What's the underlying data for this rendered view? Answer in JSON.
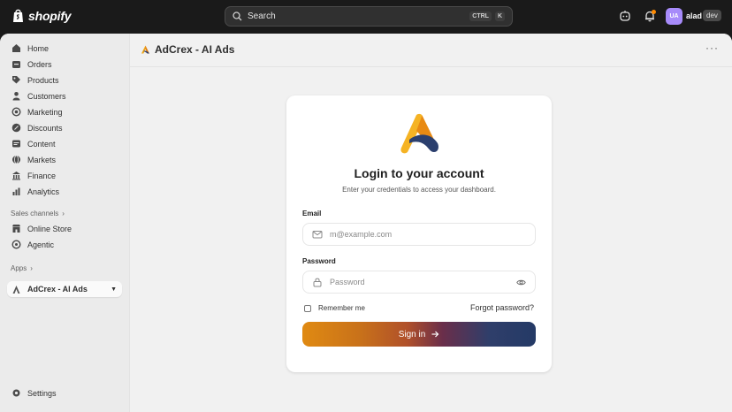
{
  "topbar": {
    "brand": "shopify",
    "search": {
      "label": "Search",
      "shortcut": [
        "CTRL",
        "K"
      ]
    },
    "user": {
      "initials": "UA",
      "name": "alad",
      "badge": "dev"
    }
  },
  "sidebar": {
    "items": [
      {
        "label": "Home",
        "icon": "home-icon"
      },
      {
        "label": "Orders",
        "icon": "orders-icon"
      },
      {
        "label": "Products",
        "icon": "tag-icon"
      },
      {
        "label": "Customers",
        "icon": "person-icon"
      },
      {
        "label": "Marketing",
        "icon": "target-icon"
      },
      {
        "label": "Discounts",
        "icon": "discount-icon"
      },
      {
        "label": "Content",
        "icon": "content-icon"
      },
      {
        "label": "Markets",
        "icon": "globe-icon"
      },
      {
        "label": "Finance",
        "icon": "bank-icon"
      },
      {
        "label": "Analytics",
        "icon": "chart-icon"
      }
    ],
    "sales_channels_label": "Sales channels",
    "sales_channels": [
      {
        "label": "Online Store",
        "icon": "store-icon"
      },
      {
        "label": "Agentic",
        "icon": "agentic-icon"
      }
    ],
    "apps_label": "Apps",
    "active_app": "AdCrex - AI Ads",
    "settings_label": "Settings"
  },
  "page": {
    "title": "AdCrex - AI Ads",
    "more": "···"
  },
  "login": {
    "title": "Login to your account",
    "subtitle": "Enter your credentials to access your dashboard.",
    "email_label": "Email",
    "email_placeholder": "m@example.com",
    "password_label": "Password",
    "password_placeholder": "Password",
    "remember_label": "Remember me",
    "forgot_label": "Forgot password?",
    "signin_label": "Sign in"
  },
  "colors": {
    "topbar_bg": "#1a1a1a",
    "accent_orange": "#e08a12",
    "accent_navy": "#243a66"
  }
}
